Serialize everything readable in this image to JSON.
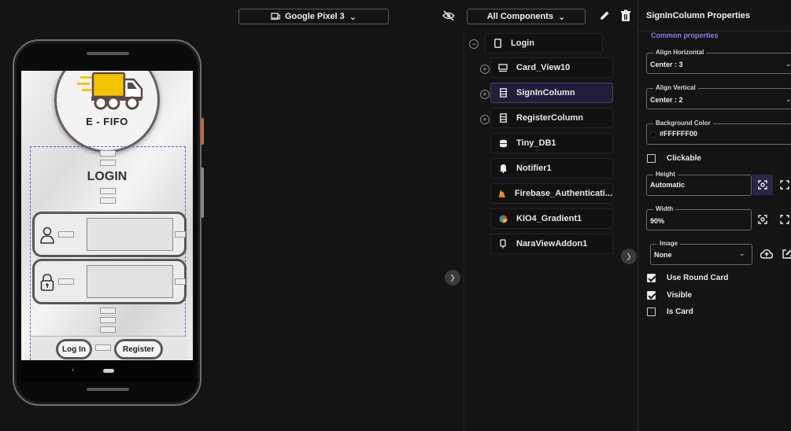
{
  "toolbar": {
    "device_label": "Google Pixel 3",
    "components_label": "All Components",
    "caret": "⌄"
  },
  "screen": {
    "logo_text": "E - FIFO",
    "title": "LOGIN",
    "login_button": "Log In",
    "register_button": "Register"
  },
  "tree": {
    "root": "Login",
    "items": [
      {
        "label": "Card_View10",
        "expandable": true
      },
      {
        "label": "SignInColumn",
        "expandable": true,
        "selected": true
      },
      {
        "label": "RegisterColumn",
        "expandable": true
      },
      {
        "label": "Tiny_DB1",
        "expandable": false
      },
      {
        "label": "Notifier1",
        "expandable": false
      },
      {
        "label": "Firebase_Authenticati...",
        "expandable": false
      },
      {
        "label": "KIO4_Gradient1",
        "expandable": false
      },
      {
        "label": "NaraViewAddon1",
        "expandable": false
      }
    ]
  },
  "props": {
    "title": "SignInColumn Properties",
    "section": "Common properties",
    "align_h_label": "Align Horizontal",
    "align_h_value": "Center : 3",
    "align_v_label": "Align Vertical",
    "align_v_value": "Center : 2",
    "bg_label": "Background Color",
    "bg_value": "#FFFFFF00",
    "clickable_label": "Clickable",
    "height_label": "Height",
    "height_value": "Automatic",
    "width_label": "Width",
    "width_value": "90%",
    "image_label": "Image",
    "image_value": "None",
    "round_card_label": "Use Round Card",
    "visible_label": "Visible",
    "is_card_label": "Is Card"
  },
  "colors": {
    "accent": "#8f7de8",
    "selected_bg": "#231d3a",
    "truck_yellow": "#f5c400",
    "truck_dark": "#5c4a4a"
  }
}
